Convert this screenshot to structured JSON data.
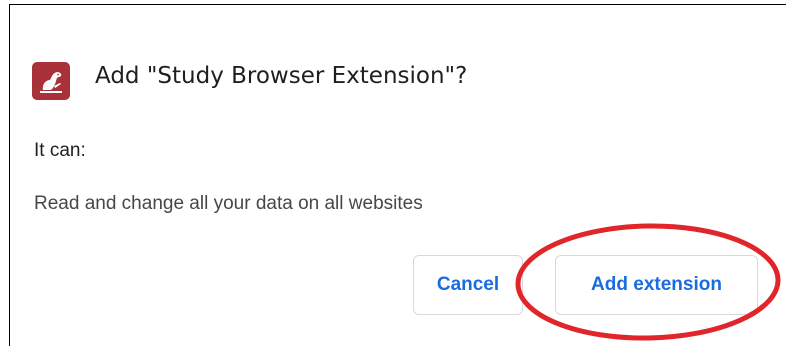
{
  "dialog": {
    "title": "Add \"Study Browser Extension\"?",
    "capabilities_heading": "It can:",
    "permissions": [
      "Read and change all your data on all websites"
    ],
    "cancel_label": "Cancel",
    "add_label": "Add extension"
  },
  "icon": {
    "name": "extension-logo-icon",
    "color": "#a8313a"
  },
  "colors": {
    "button_text": "#1a6de0",
    "highlight_ring": "#e0262b"
  }
}
